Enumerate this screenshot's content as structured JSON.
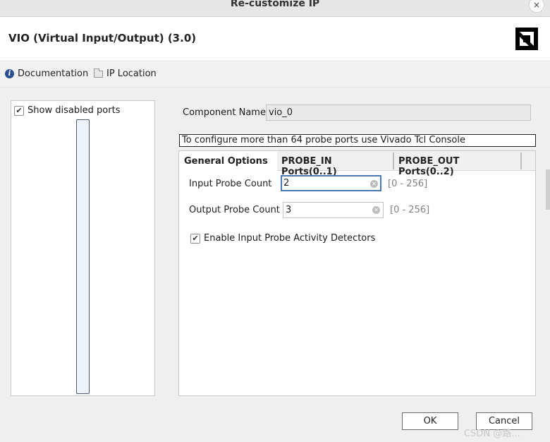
{
  "window": {
    "title": "Re-customize IP",
    "close_glyph": "×"
  },
  "header": {
    "ip_name": "VIO (Virtual Input/Output) (3.0)",
    "logo_icon": "amd-logo-icon"
  },
  "links": {
    "documentation": "Documentation",
    "ip_location": "IP Location"
  },
  "symbol_panel": {
    "show_disabled_ports_label": "Show disabled ports",
    "show_disabled_ports_checked": true
  },
  "component": {
    "label": "Component Name",
    "value": "vio_0"
  },
  "notice": "To configure more than 64 probe ports use Vivado Tcl Console",
  "tabs": [
    {
      "label": "General Options",
      "active": true
    },
    {
      "label": "PROBE_IN Ports(0..1)",
      "active": false
    },
    {
      "label": "PROBE_OUT Ports(0..2)",
      "active": false
    }
  ],
  "general": {
    "input_probe": {
      "label": "Input  Probe  Count",
      "value": "2",
      "range": "[0 - 256]"
    },
    "output_probe": {
      "label": "Output Probe Count",
      "value": "3",
      "range": "[0 - 256]"
    },
    "activity_detectors": {
      "label": "Enable Input Probe Activity Detectors",
      "checked": true
    }
  },
  "buttons": {
    "ok": "OK",
    "cancel": "Cancel"
  },
  "watermark": "CSDN @路...",
  "colors": {
    "focus_border": "#4a78b5",
    "info_icon": "#2a4f8f"
  }
}
